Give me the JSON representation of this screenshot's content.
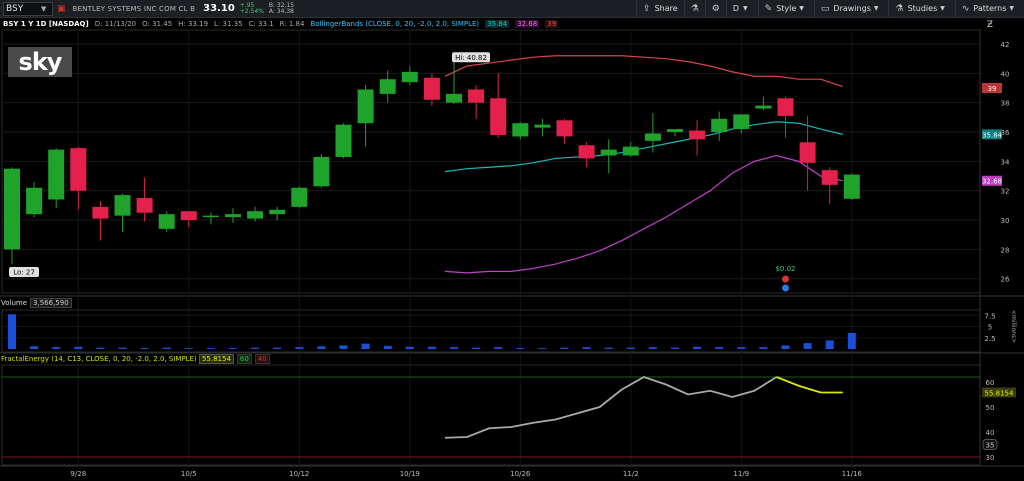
{
  "toolbar": {
    "symbol": "BSY",
    "company_name": "BENTLEY SYSTEMS INC COM CL B",
    "last_price": "33.10",
    "change": "+.95",
    "change_pct": "+2.54%",
    "bid": "B: 32.15",
    "ask": "A: 34.38",
    "share_label": "Share",
    "period_label": "D",
    "style_label": "Style",
    "drawings_label": "Drawings",
    "studies_label": "Studies",
    "patterns_label": "Patterns"
  },
  "infobar": {
    "title": "BSY 1 Y 1D [NASDAQ]",
    "date": "D: 11/13/20",
    "open": "O: 31.45",
    "high": "H: 33.19",
    "low": "L: 31.35",
    "close": "C: 33.1",
    "range": "R: 1.84",
    "bb_label": "BollingerBands (CLOSE, 0, 20, -2.0, 2.0, SIMPLE)",
    "bb_mid": "35.84",
    "bb_lower": "32.68",
    "bb_upper": "39"
  },
  "logo_text": "sky",
  "price_panel": {
    "ticks": [
      "42",
      "40",
      "38",
      "36",
      "34",
      "32",
      "30",
      "28",
      "26"
    ],
    "hi_label": "Hi: 40.82",
    "lo_label": "Lo: 27",
    "badge_upper": "39",
    "badge_mid": "35.84",
    "badge_price": "32.68",
    "dividend_label": "$0.02",
    "colors": {
      "up": "#1fa32a",
      "down": "#e3214c",
      "upper": "#d84646",
      "mid": "#1ab7b7",
      "lower": "#c040c8"
    }
  },
  "volume_panel": {
    "label": "Volume",
    "value": "3,566,590",
    "ticks": [
      "7.5",
      "5",
      "2.5"
    ],
    "axis_unit": "<millions>"
  },
  "fe_panel": {
    "label": "FractalEnergy (14, C13, CLOSE, 0, 20, -2.0, 2.0, SIMPLE)",
    "value": "55.8154",
    "v2": "60",
    "v3": "40",
    "ticks": [
      "60",
      "50",
      "40",
      "30"
    ],
    "badge": "55.8154",
    "badge2": "35"
  },
  "x_axis": [
    "9/28",
    "10/5",
    "10/12",
    "10/19",
    "10/26",
    "11/2",
    "11/9",
    "11/16"
  ],
  "chart_data": {
    "type": "candlestick",
    "xlabels": [
      "9/28",
      "10/5",
      "10/12",
      "10/19",
      "10/26",
      "11/2",
      "11/9",
      "11/16"
    ],
    "candles": [
      {
        "o": 28.0,
        "h": 33.6,
        "l": 27.0,
        "c": 33.5
      },
      {
        "o": 30.4,
        "h": 32.6,
        "l": 30.2,
        "c": 32.2
      },
      {
        "o": 31.4,
        "h": 34.9,
        "l": 30.8,
        "c": 34.8
      },
      {
        "o": 34.9,
        "h": 35.0,
        "l": 30.7,
        "c": 32.0
      },
      {
        "o": 30.9,
        "h": 31.3,
        "l": 28.6,
        "c": 30.1
      },
      {
        "o": 30.3,
        "h": 31.8,
        "l": 29.2,
        "c": 31.7
      },
      {
        "o": 31.5,
        "h": 32.9,
        "l": 29.9,
        "c": 30.5
      },
      {
        "o": 29.4,
        "h": 30.6,
        "l": 29.2,
        "c": 30.4
      },
      {
        "o": 30.6,
        "h": 30.6,
        "l": 29.5,
        "c": 30.0
      },
      {
        "o": 30.2,
        "h": 30.5,
        "l": 29.7,
        "c": 30.3
      },
      {
        "o": 30.2,
        "h": 30.8,
        "l": 29.8,
        "c": 30.4
      },
      {
        "o": 30.1,
        "h": 30.9,
        "l": 29.9,
        "c": 30.6
      },
      {
        "o": 30.4,
        "h": 30.9,
        "l": 30.0,
        "c": 30.7
      },
      {
        "o": 30.9,
        "h": 32.3,
        "l": 30.8,
        "c": 32.2
      },
      {
        "o": 32.3,
        "h": 34.5,
        "l": 32.2,
        "c": 34.3
      },
      {
        "o": 34.3,
        "h": 36.6,
        "l": 34.2,
        "c": 36.5
      },
      {
        "o": 36.6,
        "h": 39.2,
        "l": 35.0,
        "c": 38.9
      },
      {
        "o": 38.6,
        "h": 40.2,
        "l": 38.0,
        "c": 39.6
      },
      {
        "o": 39.4,
        "h": 40.5,
        "l": 39.2,
        "c": 40.1
      },
      {
        "o": 39.7,
        "h": 40.0,
        "l": 37.8,
        "c": 38.2
      },
      {
        "o": 38.0,
        "h": 40.82,
        "l": 37.9,
        "c": 38.6
      },
      {
        "o": 38.9,
        "h": 39.2,
        "l": 36.9,
        "c": 38.0
      },
      {
        "o": 38.3,
        "h": 40.0,
        "l": 35.6,
        "c": 35.8
      },
      {
        "o": 35.7,
        "h": 36.7,
        "l": 35.5,
        "c": 36.6
      },
      {
        "o": 36.3,
        "h": 36.9,
        "l": 35.7,
        "c": 36.5
      },
      {
        "o": 36.8,
        "h": 36.9,
        "l": 35.2,
        "c": 35.7
      },
      {
        "o": 35.1,
        "h": 35.3,
        "l": 33.6,
        "c": 34.2
      },
      {
        "o": 34.4,
        "h": 35.5,
        "l": 33.2,
        "c": 34.8
      },
      {
        "o": 34.4,
        "h": 35.3,
        "l": 34.3,
        "c": 35.0
      },
      {
        "o": 35.4,
        "h": 37.3,
        "l": 34.6,
        "c": 35.9
      },
      {
        "o": 36.0,
        "h": 36.2,
        "l": 35.7,
        "c": 36.2
      },
      {
        "o": 36.1,
        "h": 36.8,
        "l": 34.4,
        "c": 35.5
      },
      {
        "o": 36.0,
        "h": 37.4,
        "l": 35.4,
        "c": 36.9
      },
      {
        "o": 36.2,
        "h": 37.2,
        "l": 35.9,
        "c": 37.2
      },
      {
        "o": 37.6,
        "h": 38.4,
        "l": 37.5,
        "c": 37.8
      },
      {
        "o": 38.3,
        "h": 38.4,
        "l": 35.6,
        "c": 37.1
      },
      {
        "o": 35.3,
        "h": 37.1,
        "l": 32.0,
        "c": 33.9
      },
      {
        "o": 33.4,
        "h": 33.6,
        "l": 31.1,
        "c": 32.4
      },
      {
        "o": 31.45,
        "h": 33.19,
        "l": 31.35,
        "c": 33.1
      }
    ],
    "bb_upper": [
      39.8,
      40.5,
      40.7,
      40.9,
      41.1,
      41.2,
      41.2,
      41.2,
      41.2,
      41.1,
      41.0,
      40.8,
      40.5,
      40.1,
      39.8,
      39.8,
      39.6,
      39.6,
      39.1
    ],
    "bb_mid": [
      33.3,
      33.5,
      33.6,
      33.7,
      33.9,
      34.2,
      34.3,
      34.4,
      34.6,
      34.9,
      35.2,
      35.5,
      35.8,
      36.2,
      36.5,
      36.7,
      36.6,
      36.2,
      35.84
    ],
    "bb_lower": [
      26.5,
      26.4,
      26.5,
      26.5,
      26.7,
      27.0,
      27.4,
      27.9,
      28.6,
      29.4,
      30.2,
      31.1,
      32.0,
      33.2,
      34.0,
      34.4,
      34.0,
      33.0,
      32.68
    ],
    "volume_millions": [
      7.7,
      0.6,
      0.4,
      0.5,
      0.3,
      0.3,
      0.2,
      0.3,
      0.2,
      0.2,
      0.2,
      0.3,
      0.3,
      0.4,
      0.6,
      0.8,
      1.2,
      0.7,
      0.5,
      0.5,
      0.4,
      0.3,
      0.4,
      0.2,
      0.2,
      0.3,
      0.4,
      0.3,
      0.3,
      0.4,
      0.3,
      0.5,
      0.4,
      0.4,
      0.4,
      0.8,
      1.3,
      1.9,
      3.57
    ],
    "fractal_energy": [
      37.7,
      38.0,
      41.5,
      42.0,
      43.7,
      45.0,
      47.5,
      50.0,
      57.0,
      62.0,
      59.0,
      55.0,
      56.5,
      54.0,
      56.5,
      62.0,
      58.5,
      55.8,
      55.8
    ],
    "ylim_price": [
      25.0,
      42.5
    ]
  }
}
